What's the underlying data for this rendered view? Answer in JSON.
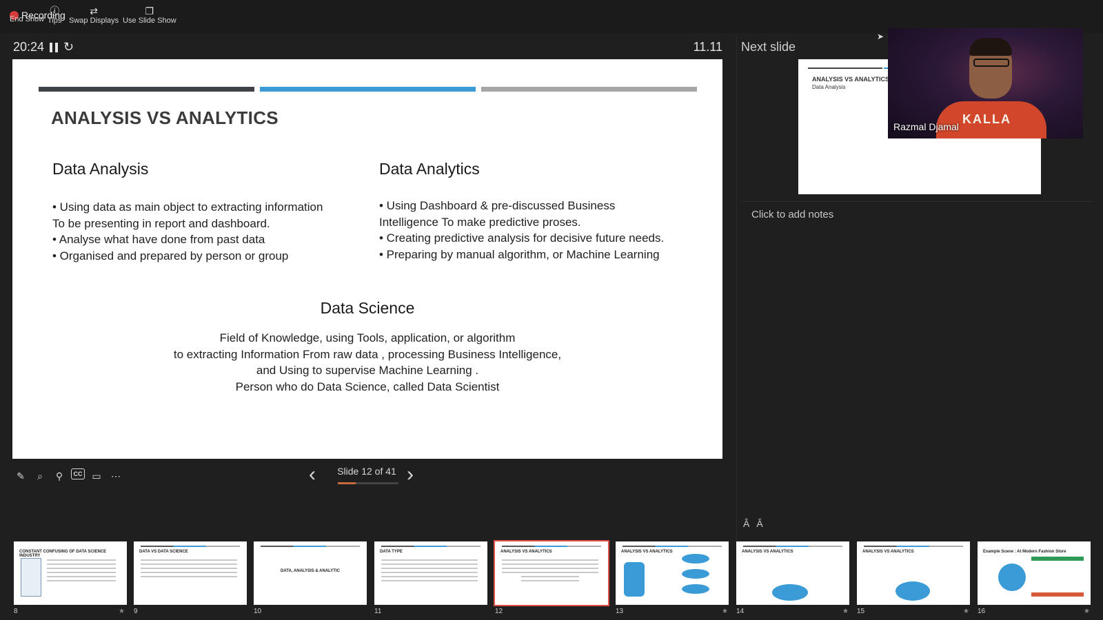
{
  "toolbar": {
    "recording_label": "Recording",
    "end_show": "End Show",
    "tips": "Tips",
    "swap_displays": "Swap Displays",
    "use_slide_show": "Use Slide Show"
  },
  "presenter": {
    "elapsed": "20:24",
    "clock": "11.11",
    "slide_counter": "Slide 12 of 41",
    "progress_fraction": 0.29
  },
  "slide": {
    "title": "ANALYSIS VS ANALYTICS",
    "bar_colors": [
      "#3f4347",
      "#3a9bd6",
      "#a6a6a6"
    ],
    "left": {
      "heading": "Data Analysis",
      "lines": [
        "•  Using data as main object to extracting information",
        "To be presenting in report and dashboard.",
        "•  Analyse what have done from past data",
        "•  Organised and prepared by person or group"
      ]
    },
    "right": {
      "heading": "Data Analytics",
      "lines": [
        "•  Using Dashboard & pre-discussed Business",
        "Intelligence To make predictive proses.",
        "•  Creating predictive analysis for decisive future needs.",
        "•  Preparing by manual algorithm, or Machine Learning"
      ]
    },
    "science": {
      "heading": "Data Science",
      "lines": [
        "Field of Knowledge, using Tools, application, or algorithm",
        "to extracting Information From raw data , processing Business Intelligence,",
        "and Using to supervise Machine Learning .",
        "Person who do Data Science, called Data Scientist"
      ]
    }
  },
  "right_panel": {
    "next_slide_label": "Next slide",
    "next_thumb_title": "ANALYSIS VS ANALYTICS",
    "next_thumb_subtitle": "Data Analysis",
    "notes_placeholder": "Click to add notes",
    "font_up": "A",
    "font_down": "A"
  },
  "video": {
    "participant_name": "Razmal Djamal",
    "shirt_text": "KALLA"
  },
  "thumbnails": [
    {
      "num": "8",
      "title": "CONSTANT CONFUSING OF DATA SCIENCE INDUSTRY"
    },
    {
      "num": "9",
      "title": "DATA VS DATA SCIENCE"
    },
    {
      "num": "10",
      "title": "DATA, ANALYSIS & ANALYTIC"
    },
    {
      "num": "11",
      "title": "DATA TYPE"
    },
    {
      "num": "12",
      "title": "ANALYSIS VS ANALYTICS"
    },
    {
      "num": "13",
      "title": "ANALYSIS VS ANALYTICS"
    },
    {
      "num": "14",
      "title": "ANALYSIS VS ANALYTICS"
    },
    {
      "num": "15",
      "title": "ANALYSIS VS ANALYTICS"
    },
    {
      "num": "16",
      "title": "Example Scene : At Modern Fashion Store"
    }
  ]
}
